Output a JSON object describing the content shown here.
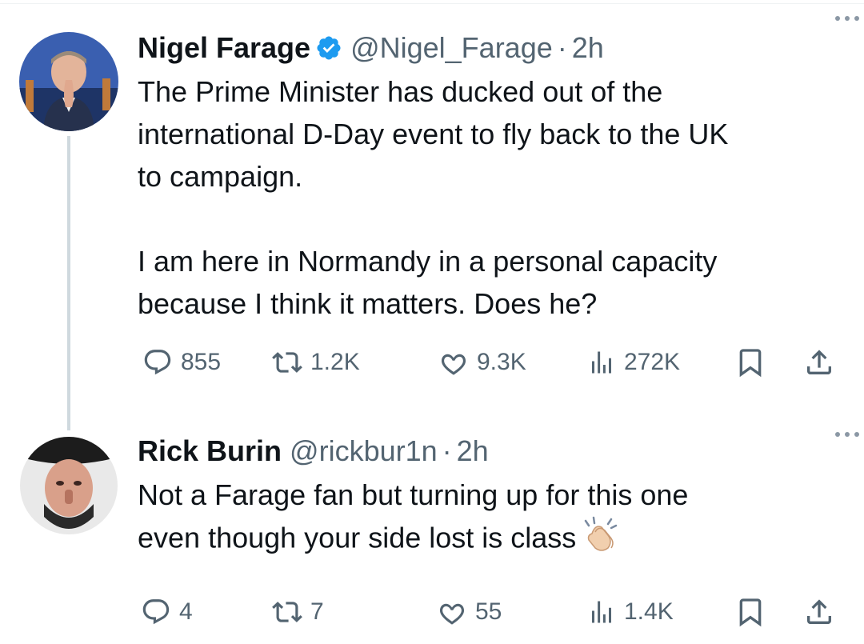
{
  "tweets": [
    {
      "author": {
        "name": "Nigel Farage",
        "verified": true,
        "handle": "@Nigel_Farage",
        "separator": "·",
        "time": "2h"
      },
      "text": "The Prime Minister has ducked out of the\ninternational D-Day event to fly back to the UK\nto campaign.\n\nI am here in Normandy in a personal capacity\nbecause I think it matters. Does he?",
      "stats": {
        "replies": "855",
        "reposts": "1.2K",
        "likes": "9.3K",
        "views": "272K"
      }
    },
    {
      "author": {
        "name": "Rick Burin",
        "handle": "@rickbur1n",
        "separator": "·",
        "time": "2h"
      },
      "text": "Not a Farage fan but turning up for this one\neven though your side lost is class",
      "emoji": "clapping-hands",
      "stats": {
        "replies": "4",
        "reposts": "7",
        "likes": "55",
        "views": "1.4K"
      }
    }
  ],
  "colors": {
    "text": "#0f1419",
    "secondary": "#536471",
    "verified": "#1d9bf0",
    "thread_line": "#cfd9de"
  }
}
